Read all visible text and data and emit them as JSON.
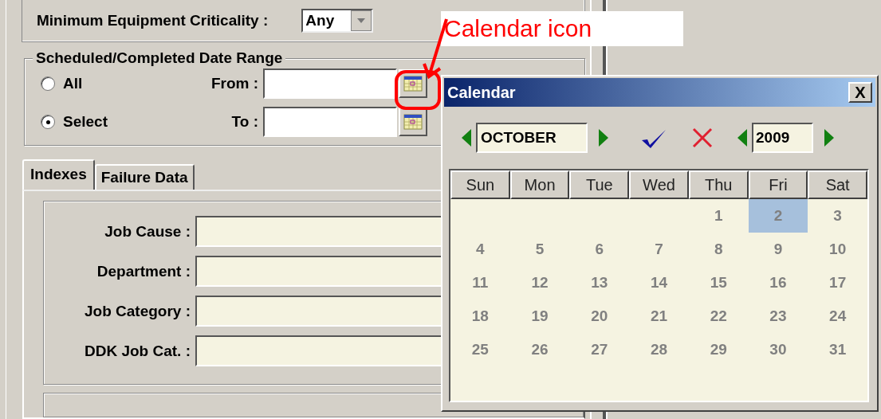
{
  "criticality": {
    "label": "Minimum Equipment Criticality :",
    "value": "Any"
  },
  "date_range": {
    "title": "Scheduled/Completed Date Range",
    "options": [
      {
        "label": "All",
        "selected": false
      },
      {
        "label": "Select",
        "selected": true
      }
    ],
    "fields": [
      {
        "label": "From :"
      },
      {
        "label": "To :"
      }
    ]
  },
  "tabs": [
    {
      "label": "Indexes",
      "selected": true
    },
    {
      "label": "Failure Data",
      "selected": false
    }
  ],
  "index_fields": [
    {
      "label": "Job Cause :"
    },
    {
      "label": "Department :"
    },
    {
      "label": "Job Category :"
    },
    {
      "label": "DDK Job Cat. :"
    }
  ],
  "annotation": {
    "text": "Calendar icon"
  },
  "calendar": {
    "title": "Calendar",
    "close": "X",
    "month": "OCTOBER",
    "year": "2009",
    "weekdays": [
      "Sun",
      "Mon",
      "Tue",
      "Wed",
      "Thu",
      "Fri",
      "Sat"
    ],
    "weeks": [
      [
        {
          "day": "1",
          "selected": false
        },
        {
          "day": "2",
          "selected": true
        },
        {
          "day": "3",
          "selected": false
        }
      ],
      [
        {
          "day": "4",
          "selected": false
        },
        {
          "day": "5",
          "selected": false
        },
        {
          "day": "6",
          "selected": false
        },
        {
          "day": "7",
          "selected": false
        },
        {
          "day": "8",
          "selected": false
        },
        {
          "day": "9",
          "selected": false
        },
        {
          "day": "10",
          "selected": false
        }
      ],
      [
        {
          "day": "11",
          "selected": false
        },
        {
          "day": "12",
          "selected": false
        },
        {
          "day": "13",
          "selected": false
        },
        {
          "day": "14",
          "selected": false
        },
        {
          "day": "15",
          "selected": false
        },
        {
          "day": "16",
          "selected": false
        },
        {
          "day": "17",
          "selected": false
        }
      ],
      [
        {
          "day": "18",
          "selected": false
        },
        {
          "day": "19",
          "selected": false
        },
        {
          "day": "20",
          "selected": false
        },
        {
          "day": "21",
          "selected": false
        },
        {
          "day": "22",
          "selected": false
        },
        {
          "day": "23",
          "selected": false
        },
        {
          "day": "24",
          "selected": false
        }
      ],
      [
        {
          "day": "25",
          "selected": false
        },
        {
          "day": "26",
          "selected": false
        },
        {
          "day": "27",
          "selected": false
        },
        {
          "day": "28",
          "selected": false
        },
        {
          "day": "29",
          "selected": false
        },
        {
          "day": "30",
          "selected": false
        },
        {
          "day": "31",
          "selected": false
        }
      ]
    ]
  }
}
